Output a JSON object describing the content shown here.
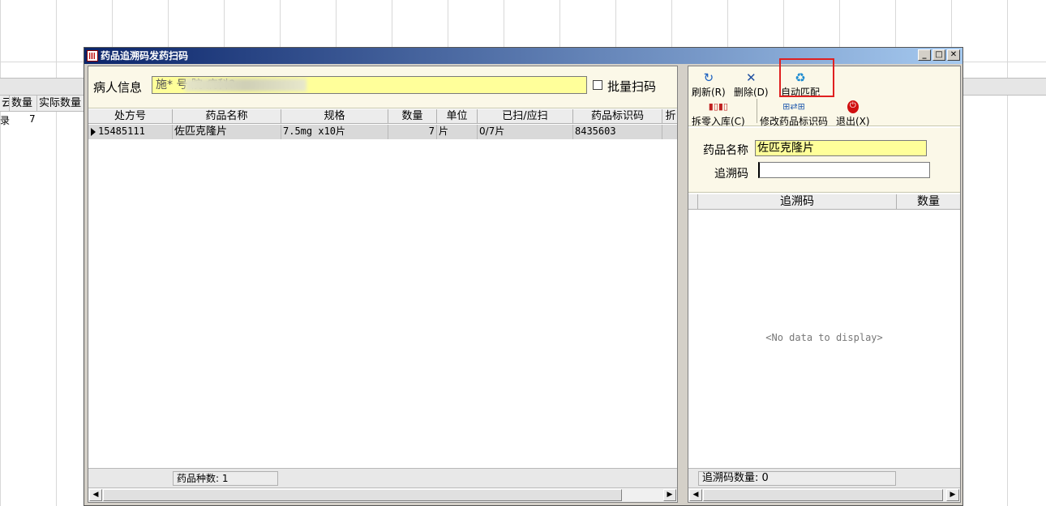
{
  "background_app": {
    "columns": [
      "云",
      "数量",
      "实际数量"
    ],
    "row": {
      "col0": "录",
      "quantity": "7"
    }
  },
  "dialog": {
    "title": "药品追溯码发药扫码",
    "window_buttons": {
      "minimize": "_",
      "maximize": "□",
      "close": "✕"
    }
  },
  "patient": {
    "label": "病人信息",
    "value": "施*                  号 院 病科?",
    "batch_scan_label": "批量扫码",
    "batch_scan_checked": false
  },
  "grid": {
    "columns": [
      "处方号",
      "药品名称",
      "规格",
      "数量",
      "单位",
      "已扫/应扫",
      "药品标识码",
      "折"
    ],
    "rows": [
      {
        "prescription_no": "15485111",
        "drug_name": "佐匹克隆片",
        "spec": "7.5mg x10片",
        "quantity": "7",
        "unit": "片",
        "scanned": "0/7片",
        "drug_code": "8435603"
      }
    ],
    "footer": "药品种数: 1"
  },
  "toolbar": {
    "refresh": "刷新(R)",
    "delete": "删除(D)",
    "auto_match": "自动匹配",
    "split_in": "拆零入库(C)",
    "edit_code": "修改药品标识码",
    "exit": "退出(X)"
  },
  "form": {
    "drug_name_label": "药品名称",
    "drug_name_value": "佐匹克隆片",
    "trace_code_label": "追溯码",
    "trace_code_value": ""
  },
  "trace_grid": {
    "columns": [
      "追溯码",
      "数量"
    ],
    "empty_text": "<No data to display>",
    "footer": "追溯码数量: 0"
  },
  "colors": {
    "title_start": "#0a246a",
    "title_end": "#a6caf0",
    "input_yellow": "#ffff9a",
    "panel_cream": "#fbf8e8",
    "highlight_red": "#e02020"
  }
}
